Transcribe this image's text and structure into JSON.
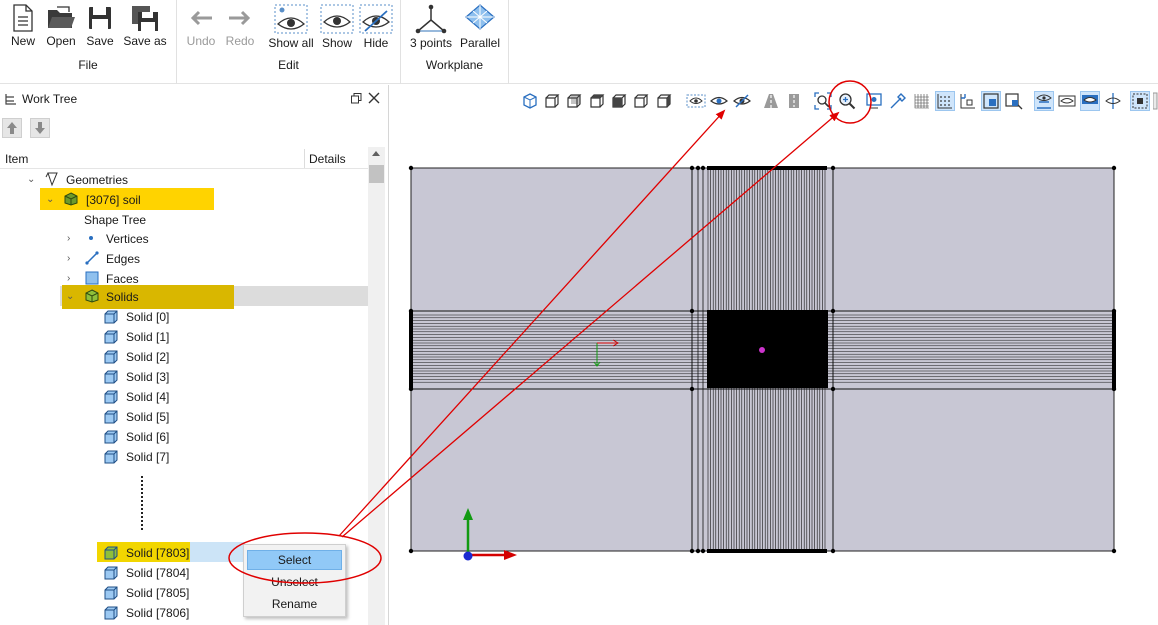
{
  "ribbon": {
    "file_group": {
      "label": "File",
      "buttons": {
        "new": "New",
        "open": "Open",
        "save": "Save",
        "save_as": "Save as"
      }
    },
    "edit_group": {
      "label": "Edit",
      "buttons": {
        "undo": "Undo",
        "redo": "Redo",
        "show_all": "Show all",
        "show": "Show",
        "hide": "Hide"
      }
    },
    "workplane_group": {
      "label": "Workplane",
      "buttons": {
        "three_points": "3 points",
        "parallel": "Parallel"
      }
    }
  },
  "panel": {
    "title": "Work Tree",
    "columns": {
      "item": "Item",
      "details": "Details"
    },
    "tree": {
      "geometries": "Geometries",
      "soil": "[3076] soil",
      "shape_tree": "Shape Tree",
      "vertices": "Vertices",
      "edges": "Edges",
      "faces": "Faces",
      "solids": "Solids",
      "solid_items_top": [
        "Solid [0]",
        "Solid [1]",
        "Solid [2]",
        "Solid [3]",
        "Solid [4]",
        "Solid [5]",
        "Solid [6]",
        "Solid [7]"
      ],
      "solid_items_bottom": [
        "Solid [7803]",
        "Solid [7804]",
        "Solid [7805]",
        "Solid [7806]"
      ]
    }
  },
  "context_menu": {
    "select": "Select",
    "unselect": "Unselect",
    "rename": "Rename"
  },
  "colors": {
    "highlight": "#ffd300",
    "annotation": "#e00000",
    "model_fill": "#c8c7d4",
    "menu_active": "#91c9f7",
    "toolbar_active": "#cfe5fb",
    "axis_x": "#d40000",
    "axis_y": "#129a12",
    "origin": "#1a2ad1",
    "center_point": "#cc33cc"
  }
}
